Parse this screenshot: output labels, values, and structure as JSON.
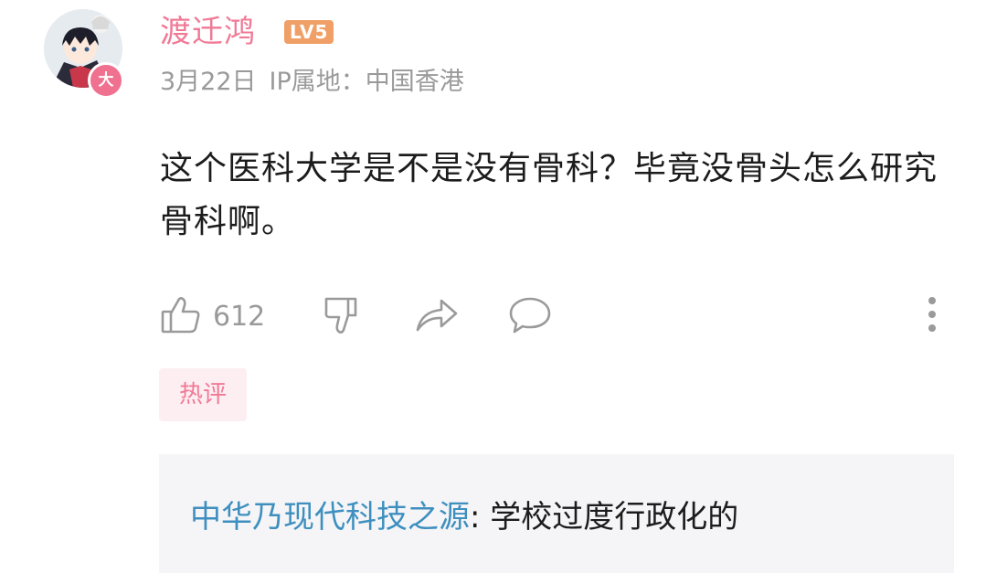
{
  "user": {
    "name": "渡迁鸿",
    "level": "LV5",
    "avatar_badge": "大"
  },
  "meta": {
    "date": "3月22日",
    "ip": "IP属地：中国香港"
  },
  "comment": {
    "text": "这个医科大学是不是没有骨科？毕竟没骨头怎么研究骨科啊。"
  },
  "actions": {
    "like_count": "612",
    "icons": [
      "thumbs-up-icon",
      "thumbs-down-icon",
      "share-icon",
      "comment-icon",
      "more-icon"
    ]
  },
  "tag": {
    "label": "热评"
  },
  "reply": {
    "author": "中华乃现代科技之源",
    "separator": ": ",
    "text": "学校过度行政化的"
  },
  "colors": {
    "username": "#f07a96",
    "level_badge": "#f0a067",
    "meta_text": "#9a9a9a",
    "reply_author": "#3e8fbf",
    "hot_tag_bg": "#fdeef2"
  }
}
